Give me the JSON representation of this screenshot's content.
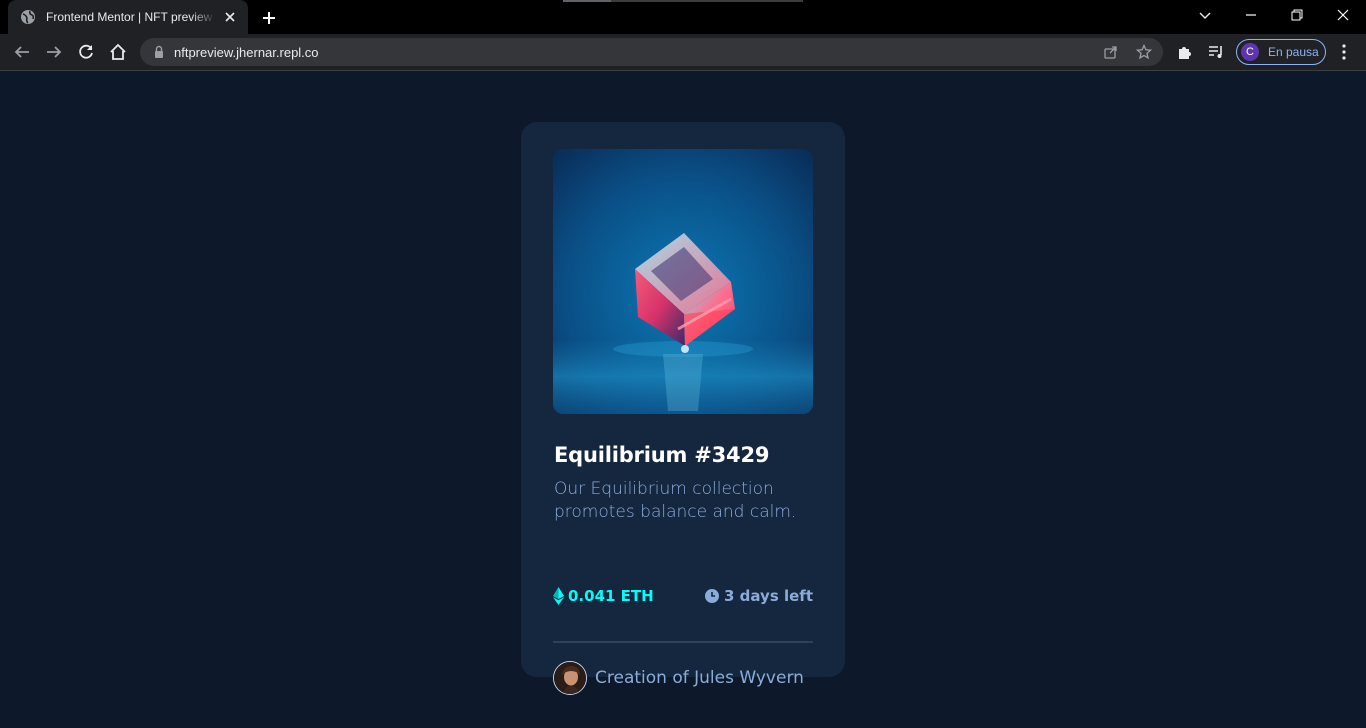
{
  "browser": {
    "tab_title": "Frontend Mentor | NFT preview card component",
    "url": "nftpreview.jhernar.repl.co",
    "profile_initial": "C",
    "profile_status": "En pausa"
  },
  "card": {
    "title": "Equilibrium #3429",
    "description": "Our Equilibrium collection promotes balance and calm.",
    "price": "0.041 ETH",
    "time_left": "3 days left",
    "creator_prefix": "Creation of",
    "creator_name": "Jules Wyvern"
  },
  "colors": {
    "page_bg": "#0d192b",
    "card_bg": "#15263f",
    "accent_cyan": "#00fff8",
    "soft_blue": "#8bacd9",
    "white": "#ffffff"
  },
  "icons": {
    "price": "ethereum-icon",
    "time": "clock-icon"
  }
}
